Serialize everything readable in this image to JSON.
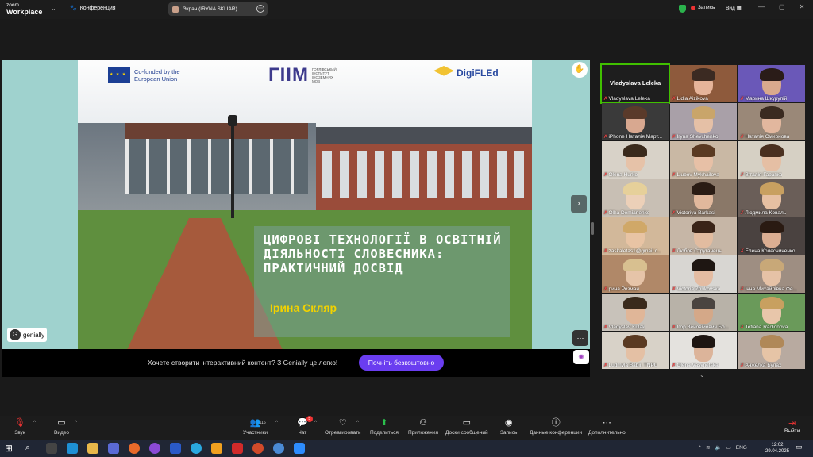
{
  "app": {
    "logo_small": "zoom",
    "logo_big": "Workplace",
    "conference_label": "Конференция",
    "share_label": "Экран (IRYNA SKLIAR)",
    "record_label": "Запись",
    "view_label": "Вид"
  },
  "slide": {
    "eu_text_1": "Co-funded by the",
    "eu_text_2": "European Union",
    "giim_big": "ГІІМ",
    "giim_small_1": "ГОРЛІВСЬКИЙ",
    "giim_small_2": "ІНСТИТУТ",
    "giim_small_3": "ІНОЗЕМНИХ",
    "giim_small_4": "МОВ",
    "digi": "DigiFLEd",
    "title": "ЦИФРОВІ ТЕХНОЛОГІЇ В ОСВІТНІЙ ДІЯЛЬНОСТІ СЛОВЕСНИКА: ПРАКТИЧНИЙ ДОСВІД",
    "author": "Ірина Скляр",
    "genially_small": "Powered by",
    "genially": "genially"
  },
  "banner": {
    "text": "Хочете створити інтерактивний контент? З Genially це легко!",
    "button": "Почніть безкоштовно"
  },
  "gallery": {
    "speaker_name": "Vladyslava Leleka",
    "tiles": [
      {
        "name": "Vladyslava Leleka",
        "muted": true,
        "bg": "#1e1e1e",
        "skin": "#e3b79c",
        "hair": "#7a4a2a",
        "speaker": true
      },
      {
        "name": "Lidia Aizikova",
        "muted": true,
        "bg": "#8e5a3c",
        "skin": "#e6b49a",
        "hair": "#3b2a22"
      },
      {
        "name": "Марина Шкурупій",
        "muted": true,
        "bg": "#6a58b8",
        "skin": "#d9a98d",
        "hair": "#2a1c18"
      },
      {
        "name": "iPhone Наталія Март...",
        "muted": true,
        "bg": "#3a3a3a",
        "skin": "#d8a890",
        "hair": "#5a3a2a"
      },
      {
        "name": "Iryna Shevchenko",
        "muted": true,
        "bg": "#a9a0a8",
        "skin": "#e5c0a6",
        "hair": "#c9a56a"
      },
      {
        "name": "Наталія Смирнова",
        "muted": true,
        "bg": "#9a8878",
        "skin": "#e2b79e",
        "hair": "#3a2a20"
      },
      {
        "name": "Olena Hurko",
        "muted": true,
        "bg": "#d8d2c8",
        "skin": "#e6c2a8",
        "hair": "#3a2a1c"
      },
      {
        "name": "Liubov Mykhailova",
        "muted": true,
        "bg": "#c9b8a4",
        "skin": "#e7c0a6",
        "hair": "#5a3a22"
      },
      {
        "name": "Віталія Гарапко",
        "muted": true,
        "bg": "#d6d0c4",
        "skin": "#e5bfa4",
        "hair": "#4a3020"
      },
      {
        "name": "Olha Demianenko",
        "muted": true,
        "bg": "#c8bfb4",
        "skin": "#ecd0b8",
        "hair": "#e6d09a"
      },
      {
        "name": "Victoriya Barkasi",
        "muted": true,
        "bg": "#8a7868",
        "skin": "#e1b89c",
        "hair": "#2a1c14"
      },
      {
        "name": "Людмила Коваль",
        "muted": true,
        "bg": "#6a5e58",
        "skin": "#e6c0a2",
        "hair": "#c8a060"
      },
      {
        "name": "zaskaletas1@gmail.c...",
        "muted": true,
        "bg": "#d2b89a",
        "skin": "#e8c4a4",
        "hair": "#d0a868"
      },
      {
        "name": "Любов Струганець",
        "muted": true,
        "bg": "#c6b6a6",
        "skin": "#e2bca0",
        "hair": "#3a2418"
      },
      {
        "name": "Елена Колесниченко",
        "muted": true,
        "bg": "#4a4240",
        "skin": "#dcae92",
        "hair": "#2a1a12"
      },
      {
        "name": "рина Розман",
        "muted": true,
        "bg": "#b08868",
        "skin": "#e6c4a8",
        "hair": "#d8c090"
      },
      {
        "name": "Victoria Zhukovska",
        "muted": true,
        "bg": "#d8d6d2",
        "skin": "#e4bca2",
        "hair": "#1e1612"
      },
      {
        "name": "Інна Михайлівна Фе...",
        "muted": true,
        "bg": "#9e8e82",
        "skin": "#e6c2a6",
        "hair": "#c8a878"
      },
      {
        "name": "Vladyslav Kulak",
        "muted": true,
        "bg": "#c8c2ba",
        "skin": "#e0b698",
        "hair": "#3a2a1c"
      },
      {
        "name": "Ігор Зеновійович Бо...",
        "muted": true,
        "bg": "#b8b2a8",
        "skin": "#d4a888",
        "hair": "#4a4440"
      },
      {
        "name": "Tetiana Radionova",
        "muted": true,
        "bg": "#6a9a5a",
        "skin": "#e8c6aa",
        "hair": "#c8a060"
      },
      {
        "name": "Ludmyla Babii, TNPU",
        "muted": true,
        "bg": "#d8d2c8",
        "skin": "#e4c0a4",
        "hair": "#5a3a22"
      },
      {
        "name": "Olena Vasynetska",
        "muted": true,
        "bg": "#e4e2de",
        "skin": "#dcb49a",
        "hair": "#1e1612"
      },
      {
        "name": "Анжелка Булах",
        "muted": true,
        "bg": "#b8aaa0",
        "skin": "#e6c4a6",
        "hair": "#b08858"
      }
    ]
  },
  "toolbar": {
    "sound": "Звук",
    "video": "Видео",
    "participants": "Участники",
    "participants_count": "116",
    "chat": "Чат",
    "chat_badge": "5",
    "react": "Отреагировать",
    "share": "Поделиться",
    "apps": "Приложения",
    "board": "Доски сообщений",
    "record": "Запись",
    "info": "Данные конференции",
    "more": "Дополнительно",
    "exit": "Выйти"
  },
  "taskbar": {
    "lang": "ENG",
    "time": "12:02",
    "date": "29.04.2025"
  }
}
